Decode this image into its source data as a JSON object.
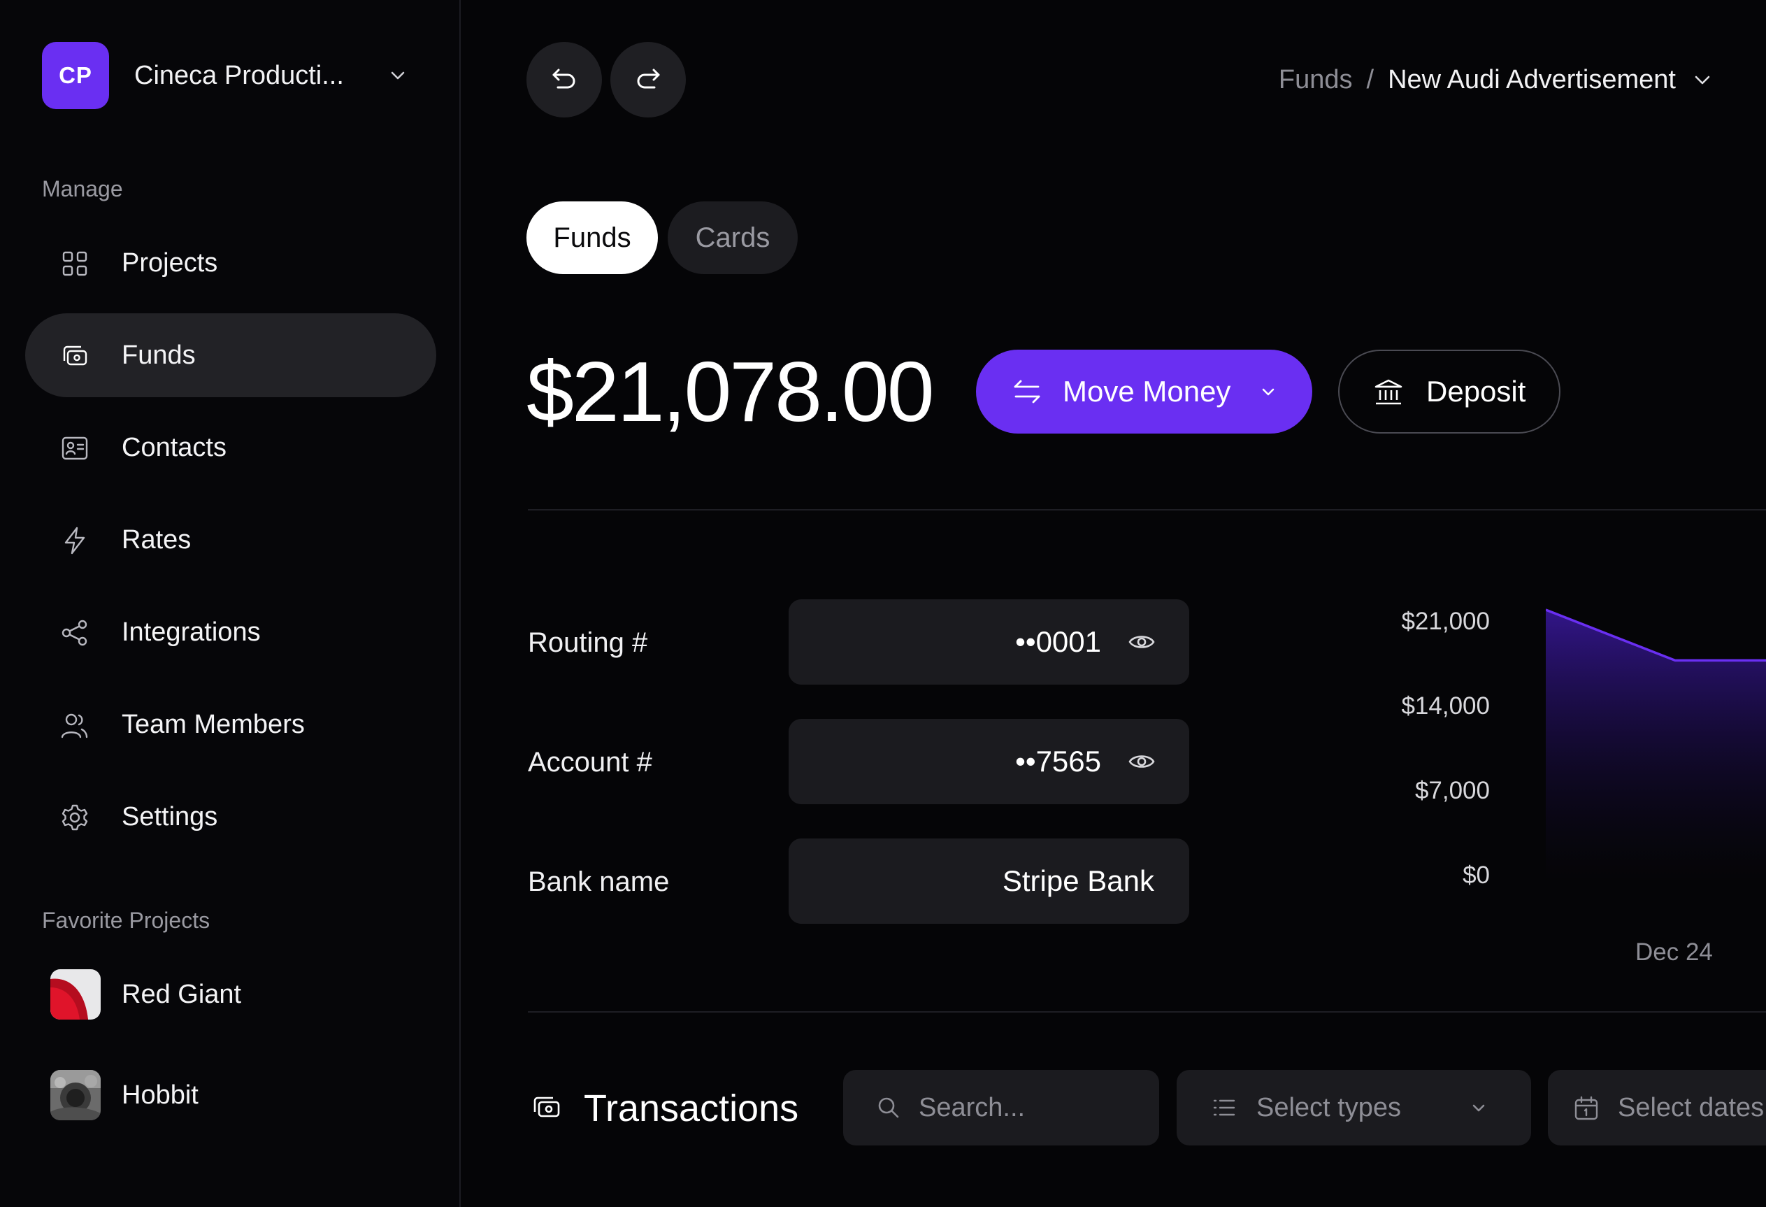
{
  "workspace": {
    "initials": "CP",
    "name": "Cineca Producti...",
    "badge_color": "#6a2ff2"
  },
  "sidebar": {
    "manage_label": "Manage",
    "items": [
      {
        "label": "Projects",
        "icon": "grid-icon",
        "active": false
      },
      {
        "label": "Funds",
        "icon": "wallet-icon",
        "active": true
      },
      {
        "label": "Contacts",
        "icon": "contact-card-icon",
        "active": false
      },
      {
        "label": "Rates",
        "icon": "lightning-icon",
        "active": false
      },
      {
        "label": "Integrations",
        "icon": "share-nodes-icon",
        "active": false
      },
      {
        "label": "Team Members",
        "icon": "users-icon",
        "active": false
      },
      {
        "label": "Settings",
        "icon": "gear-icon",
        "active": false
      }
    ],
    "favorites_label": "Favorite Projects",
    "favorites": [
      {
        "label": "Red Giant",
        "icon": "red-giant-thumbnail"
      },
      {
        "label": "Hobbit",
        "icon": "hobbit-thumbnail"
      }
    ]
  },
  "toolbar": {
    "undo_icon": "undo-icon",
    "redo_icon": "redo-icon"
  },
  "breadcrumb": {
    "parent": "Funds",
    "separator": "/",
    "current": "New Audi Advertisement"
  },
  "tabs": [
    {
      "label": "Funds",
      "active": true
    },
    {
      "label": "Cards",
      "active": false
    }
  ],
  "balance": "$21,078.00",
  "actions": {
    "move_money": "Move Money",
    "deposit": "Deposit",
    "accent": "#6a2ff2"
  },
  "account": {
    "routing_label": "Routing #",
    "routing_value": "••0001",
    "account_label": "Account #",
    "account_value": "••7565",
    "bank_label": "Bank name",
    "bank_value": "Stripe Bank"
  },
  "chart_data": {
    "type": "area",
    "title": "",
    "xlabel": "",
    "ylabel": "",
    "y_ticks": [
      "$21,000",
      "$14,000",
      "$7,000",
      "$0"
    ],
    "x_ticks": [
      "Dec 24"
    ],
    "ylim": [
      0,
      21000
    ],
    "series": [
      {
        "values": [
          21000,
          17000,
          17000,
          17000
        ]
      }
    ],
    "color": "#6a2ff2"
  },
  "transactions": {
    "title": "Transactions",
    "search_placeholder": "Search...",
    "types_placeholder": "Select types",
    "dates_placeholder": "Select dates"
  }
}
